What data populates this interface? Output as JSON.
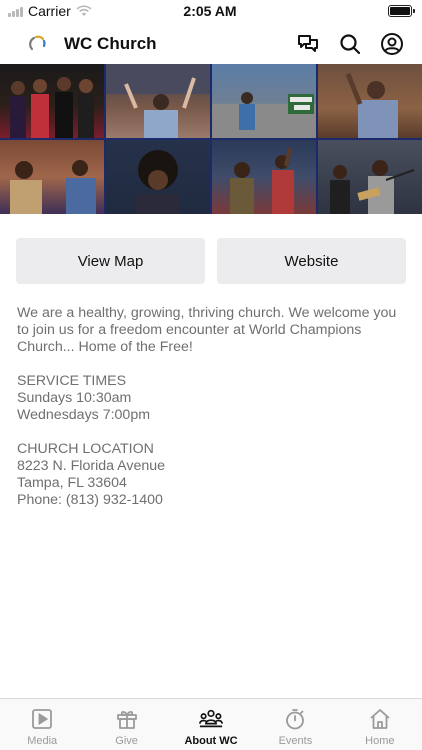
{
  "status_bar": {
    "carrier": "Carrier",
    "time": "2:05 AM"
  },
  "header": {
    "title": "WC Church"
  },
  "buttons": {
    "view_map": "View Map",
    "website": "Website"
  },
  "about": {
    "intro": "We are a healthy, growing, thriving church. We welcome you to join us for a freedom encounter at World Champions Church... Home of the Free!",
    "service_heading": "SERVICE TIMES",
    "service_sunday": "Sundays 10:30am",
    "service_wednesday": "Wednesdays 7:00pm",
    "location_heading": "CHURCH LOCATION",
    "address_line1": "8223 N. Florida Avenue",
    "address_line2": "Tampa, FL 33604",
    "phone": "Phone: (813) 932-1400"
  },
  "tabs": [
    {
      "label": "Media",
      "icon": "media-play-icon",
      "active": false
    },
    {
      "label": "Give",
      "icon": "gift-icon",
      "active": false
    },
    {
      "label": "About WC",
      "icon": "group-icon",
      "active": true
    },
    {
      "label": "Events",
      "icon": "stopwatch-icon",
      "active": false
    },
    {
      "label": "Home",
      "icon": "home-icon",
      "active": false
    }
  ],
  "colors": {
    "accent": "#111111",
    "tab_inactive": "#9a9a9a",
    "collage_border": "#1c2a6b"
  }
}
